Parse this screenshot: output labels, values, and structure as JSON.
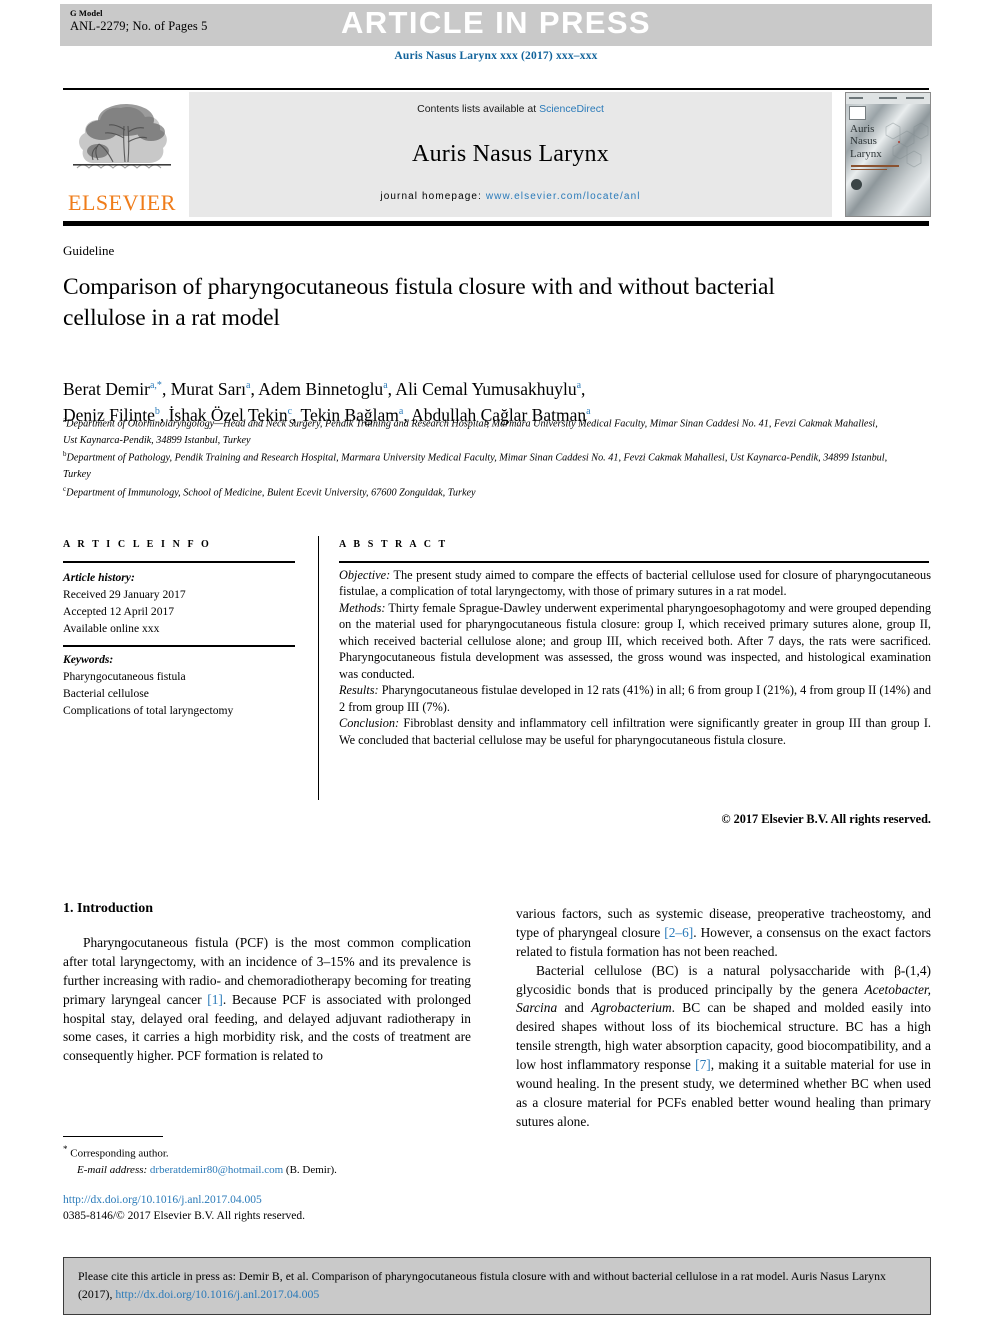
{
  "header": {
    "g_model_label": "G Model",
    "article_id": "ANL-2279; No. of Pages 5",
    "status_banner": "ARTICLE IN PRESS",
    "journal_reference": "Auris Nasus Larynx xxx (2017) xxx–xxx"
  },
  "masthead": {
    "contents_prefix": "Contents lists available at ",
    "sciencedirect": "ScienceDirect",
    "journal_title": "Auris Nasus Larynx",
    "homepage_label": "journal homepage: ",
    "homepage_url": "www.elsevier.com/locate/anl",
    "publisher": "ELSEVIER",
    "cover_title_lines": [
      "Auris",
      "Nasus",
      "Larynx"
    ]
  },
  "article": {
    "type": "Guideline",
    "title": "Comparison of pharyngocutaneous fistula closure with and without bacterial cellulose in a rat model",
    "authors_line_1": "Berat Demir a,*, Murat Sarı a, Adem Binnetoglu a, Ali Cemal Yumusakhuylu a,",
    "authors_line_2": "Deniz Filinte b, İshak Özel Tekin c, Tekin Bağlam a, Abdullah Çağlar Batman a",
    "affiliations": [
      {
        "marker": "a",
        "text": "Department of Otorhinolaryngology—Head and Neck Surgery, Pendik Training and Research Hospital, Marmara University Medical Faculty, Mimar Sinan Caddesi No. 41, Fevzi Cakmak Mahallesi, Ust Kaynarca-Pendik, 34899 Istanbul, Turkey"
      },
      {
        "marker": "b",
        "text": "Department of Pathology, Pendik Training and Research Hospital, Marmara University Medical Faculty, Mimar Sinan Caddesi No. 41, Fevzi Cakmak Mahallesi, Ust Kaynarca-Pendik, 34899 Istanbul, Turkey"
      },
      {
        "marker": "c",
        "text": "Department of Immunology, School of Medicine, Bulent Ecevit University, 67600 Zonguldak, Turkey"
      }
    ]
  },
  "article_info": {
    "heading": "A R T I C L E   I N F O",
    "history_label": "Article history:",
    "received": "Received 29 January 2017",
    "accepted": "Accepted 12 April 2017",
    "available": "Available online xxx",
    "keywords_label": "Keywords:",
    "keywords": [
      "Pharyngocutaneous fistula",
      "Bacterial cellulose",
      "Complications of total laryngectomy"
    ]
  },
  "abstract": {
    "heading": "A B S T R A C T",
    "objective_label": "Objective:",
    "objective_text": " The present study aimed to compare the effects of bacterial cellulose used for closure of pharyngocutaneous fistulae, a complication of total laryngectomy, with those of primary sutures in a rat model.",
    "methods_label": "Methods:",
    "methods_text": " Thirty female Sprague-Dawley underwent experimental pharyngoesophagotomy and were grouped depending on the material used for pharyngocutaneous fistula closure: group I, which received primary sutures alone, group II, which received bacterial cellulose alone; and group III, which received both. After 7 days, the rats were sacrificed. Pharyngocutaneous fistula development was assessed, the gross wound was inspected, and histological examination was conducted.",
    "results_label": "Results:",
    "results_text": " Pharyngocutaneous fistulae developed in 12 rats (41%) in all; 6 from group I (21%), 4 from group II (14%) and 2 from group III (7%).",
    "conclusion_label": "Conclusion:",
    "conclusion_text": " Fibroblast density and inflammatory cell infiltration were significantly greater in group III than group I. We concluded that bacterial cellulose may be useful for pharyngocutaneous fistula closure.",
    "copyright": "© 2017 Elsevier B.V. All rights reserved."
  },
  "body": {
    "section_heading": "1. Introduction",
    "left_paragraph_pre": "Pharyngocutaneous fistula (PCF) is the most common complication after total laryngectomy, with an incidence of 3–15% and its prevalence is further increasing with radio- and chemoradiotherapy becoming for treating primary laryngeal cancer ",
    "left_ref_1": "[1]",
    "left_paragraph_post": ". Because PCF is associated with prolonged hospital stay, delayed oral feeding, and delayed adjuvant radiotherapy in some cases, it carries a high morbidity risk, and the costs of treatment are consequently higher. PCF formation is related to",
    "right_p1_pre": "various factors, such as systemic disease, preoperative tracheostomy, and type of pharyngeal closure ",
    "right_ref_26": "[2–6]",
    "right_p1_post": ". However, a consensus on the exact factors related to fistula formation has not been reached.",
    "right_p2_a": "Bacterial cellulose (BC) is a natural polysaccharide with β-(1,4) glycosidic bonds that is produced principally by the genera ",
    "right_p2_genera1": "Acetobacter, Sarcina",
    "right_p2_b": " and ",
    "right_p2_genera2": "Agrobacterium",
    "right_p2_c": ". BC can be shaped and molded easily into desired shapes without loss of its biochemical structure. BC has a high tensile strength, high water absorption capacity, good biocompatibility, and a low host inflammatory response ",
    "right_ref_7": "[7]",
    "right_p2_d": ", making it a suitable material for use in wound healing. In the present study, we determined whether BC when used as a closure material for PCFs enabled better wound healing than primary sutures alone."
  },
  "footnote": {
    "corresponding": "Corresponding author.",
    "email_label": "E-mail address:",
    "email": "drberatdemir80@hotmail.com",
    "email_owner": "(B. Demir).",
    "doi_url": "http://dx.doi.org/10.1016/j.anl.2017.04.005",
    "issn_line": "0385-8146/© 2017 Elsevier B.V. All rights reserved."
  },
  "cite_box": {
    "text_pre": "Please cite this article in press as: Demir B, et al. Comparison of pharyngocutaneous fistula closure with and without bacterial cellulose in a rat model. Auris Nasus Larynx (2017), ",
    "link": "http://dx.doi.org/10.1016/j.anl.2017.04.005"
  },
  "colors": {
    "link_blue": "#2a7ab9",
    "journal_ref_blue": "#11639b",
    "elsevier_orange": "#ef7c1a",
    "banner_gray": "#c9c9c9",
    "masthead_gray": "#e8e8e8"
  }
}
